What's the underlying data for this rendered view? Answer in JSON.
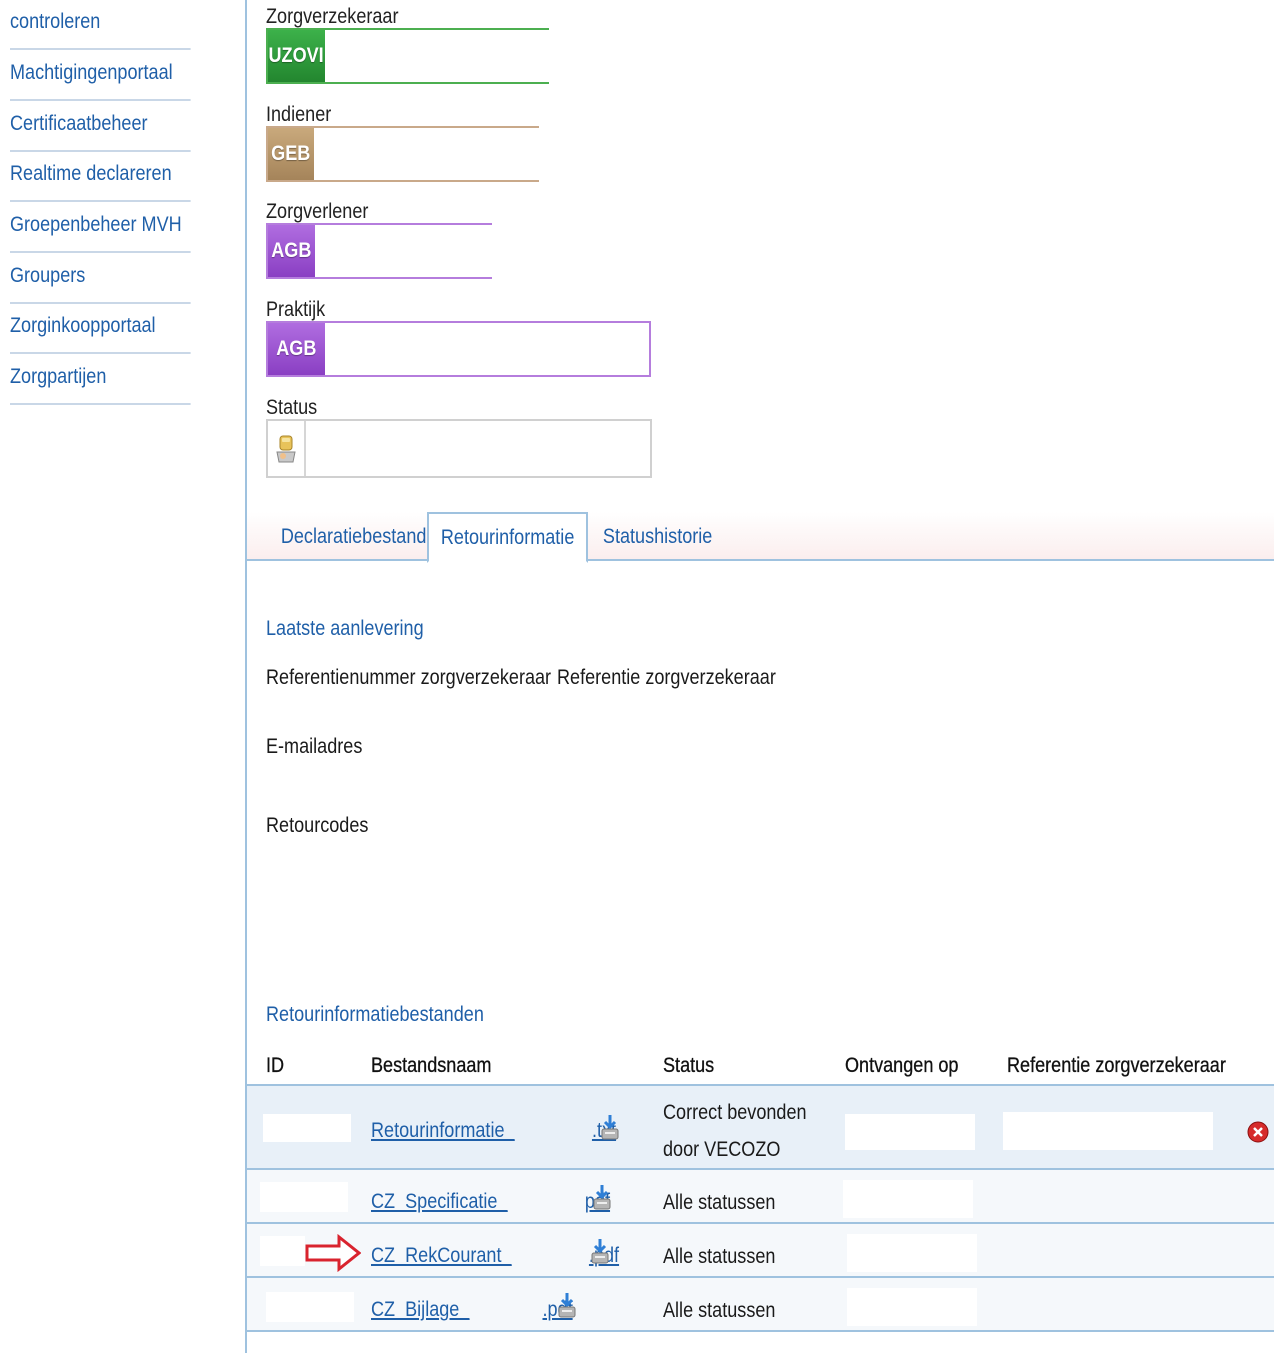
{
  "sidebar": {
    "items": [
      {
        "label": "controleren"
      },
      {
        "label": "Machtigingenportaal"
      },
      {
        "label": "Certificaatbeheer"
      },
      {
        "label": "Realtime declareren"
      },
      {
        "label": "Groepenbeheer MVH"
      },
      {
        "label": "Groupers"
      },
      {
        "label": "Zorginkoopportaal"
      },
      {
        "label": "Zorgpartijen"
      }
    ]
  },
  "fields": {
    "zorgverzekeraar": {
      "label": "Zorgverzekeraar",
      "prefix": "UZOVI",
      "value": ""
    },
    "indiener": {
      "label": "Indiener",
      "prefix": "GEB",
      "value": ""
    },
    "zorgverlener": {
      "label": "Zorgverlener",
      "prefix": "AGB",
      "value": ""
    },
    "praktijk": {
      "label": "Praktijk",
      "prefix": "AGB",
      "value": ""
    },
    "status": {
      "label": "Status",
      "value": ""
    }
  },
  "colors": {
    "uzovi": "#2e9a3a",
    "geb": "#b8976a",
    "agb": "#9b4fd0",
    "link": "#1f5fa8",
    "accent_line": "#9fc2df"
  },
  "tabs": [
    {
      "label": "Declaratiebestand",
      "active": false
    },
    {
      "label": "Retourinformatie",
      "active": true
    },
    {
      "label": "Statushistorie",
      "active": false
    }
  ],
  "laatste": {
    "title": "Laatste aanlevering",
    "ref_nummer_label": "Referentienummer zorgverzekeraar",
    "ref_label": "Referentie zorgverzekeraar",
    "email_label": "E-mailadres",
    "retourcodes_label": "Retourcodes"
  },
  "bestanden": {
    "title": "Retourinformatiebestanden",
    "columns": {
      "id": "ID",
      "bestandsnaam": "Bestandsnaam",
      "status": "Status",
      "ontvangen": "Ontvangen op",
      "referentie": "Referentie zorgverzekeraar"
    },
    "rows": [
      {
        "name_prefix": "Retourinformatie_",
        "name_suffix": ".txt",
        "status_line1": "Correct bevonden",
        "status_line2": "door VECOZO"
      },
      {
        "name_prefix": "CZ_Specificatie_",
        "name_suffix": "pdf",
        "status_line1": "Alle statussen"
      },
      {
        "name_prefix": "CZ_RekCourant_",
        "name_suffix": ".pdf",
        "status_line1": "Alle statussen"
      },
      {
        "name_prefix": "CZ_Bijlage_",
        "name_suffix": ".pdf",
        "status_line1": "Alle statussen"
      }
    ]
  }
}
